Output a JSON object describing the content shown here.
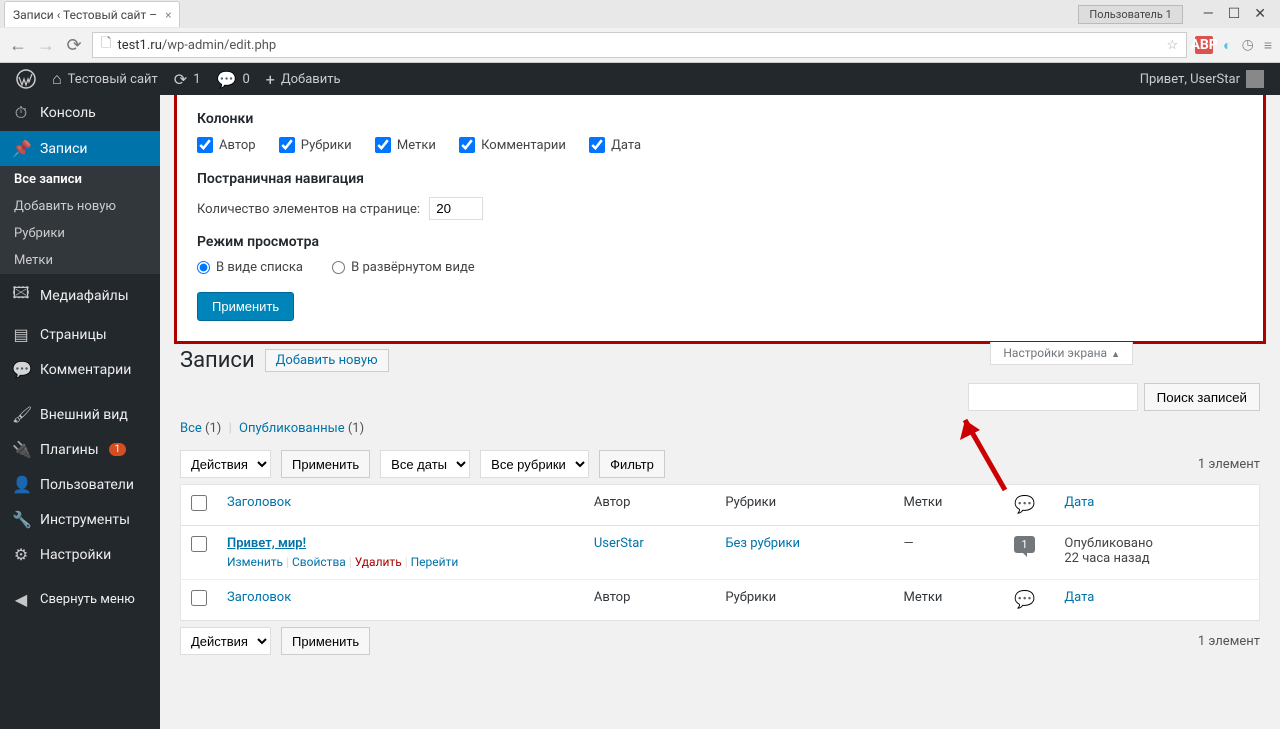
{
  "browser": {
    "tab_title": "Записи ‹ Тестовый сайт –",
    "user_badge": "Пользователь 1",
    "url_host": "test1.ru",
    "url_path": "/wp-admin/edit.php"
  },
  "adminbar": {
    "site_name": "Тестовый сайт",
    "updates": "1",
    "comments": "0",
    "add_new": "Добавить",
    "greeting": "Привет, UserStar"
  },
  "sidebar": {
    "items": [
      {
        "label": "Консоль",
        "icon": "dashboard"
      },
      {
        "label": "Записи",
        "icon": "pin",
        "current": true
      },
      {
        "label": "Медиафайлы",
        "icon": "media"
      },
      {
        "label": "Страницы",
        "icon": "pages"
      },
      {
        "label": "Комментарии",
        "icon": "comments"
      },
      {
        "label": "Внешний вид",
        "icon": "brush"
      },
      {
        "label": "Плагины",
        "icon": "plug",
        "badge": "1"
      },
      {
        "label": "Пользователи",
        "icon": "user"
      },
      {
        "label": "Инструменты",
        "icon": "wrench"
      },
      {
        "label": "Настройки",
        "icon": "sliders"
      }
    ],
    "submenu": [
      "Все записи",
      "Добавить новую",
      "Рубрики",
      "Метки"
    ],
    "collapse": "Свернуть меню"
  },
  "screen_options": {
    "columns_title": "Колонки",
    "columns": [
      "Автор",
      "Рубрики",
      "Метки",
      "Комментарии",
      "Дата"
    ],
    "pagination_title": "Постраничная навигация",
    "per_page_label": "Количество элементов на странице:",
    "per_page_value": "20",
    "view_title": "Режим просмотра",
    "view_list": "В виде списка",
    "view_excerpt": "В развёрнутом виде",
    "apply": "Применить",
    "tab_label": "Настройки экрана"
  },
  "page": {
    "title": "Записи",
    "add_new": "Добавить новую"
  },
  "filters": {
    "all": "Все",
    "all_count": "(1)",
    "published": "Опубликованные",
    "published_count": "(1)"
  },
  "tablenav": {
    "bulk_placeholder": "Действия",
    "apply": "Применить",
    "all_dates": "Все даты",
    "all_cats": "Все рубрики",
    "filter": "Фильтр",
    "count": "1 элемент"
  },
  "search": {
    "button": "Поиск записей"
  },
  "table": {
    "headers": {
      "title": "Заголовок",
      "author": "Автор",
      "cats": "Рубрики",
      "tags": "Метки",
      "date": "Дата"
    },
    "rows": [
      {
        "title": "Привет, мир!",
        "author": "UserStar",
        "cats": "Без рубрики",
        "tags": "—",
        "comments": "1",
        "date_status": "Опубликовано",
        "date_rel": "22 часа назад",
        "actions": {
          "edit": "Изменить",
          "quick": "Свойства",
          "trash": "Удалить",
          "view": "Перейти"
        }
      }
    ]
  }
}
